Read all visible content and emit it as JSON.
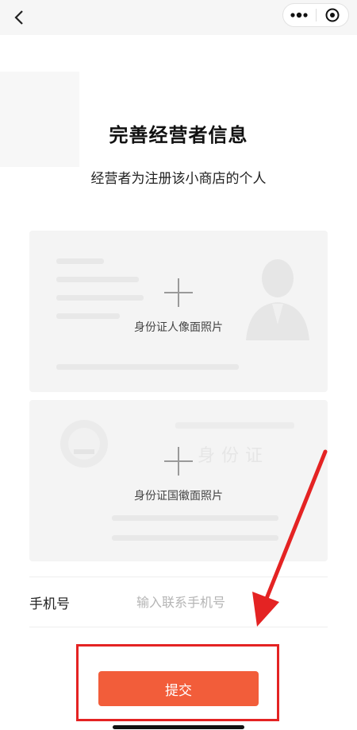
{
  "header": {
    "back_icon": "chevron-left-icon",
    "more_icon": "more-dots-icon",
    "close_icon": "target-circle-icon"
  },
  "page": {
    "title": "完善经营者信息",
    "subtitle": "经营者为注册该小商店的个人"
  },
  "id_front": {
    "label": "身份证人像面照片",
    "icon": "plus-icon",
    "portrait_icon": "person-silhouette-icon"
  },
  "id_back": {
    "label": "身份证国徽面照片",
    "icon": "plus-icon",
    "emblem_icon": "national-emblem-icon",
    "watermark_text": "身份证"
  },
  "phone": {
    "label": "手机号",
    "placeholder": "输入联系手机号",
    "value": ""
  },
  "actions": {
    "submit_label": "提交"
  },
  "annotation": {
    "highlight_color": "#e42323",
    "arrow_color": "#e42323"
  },
  "colors": {
    "accent": "#f25d3a",
    "card_bg": "#f4f4f4"
  }
}
